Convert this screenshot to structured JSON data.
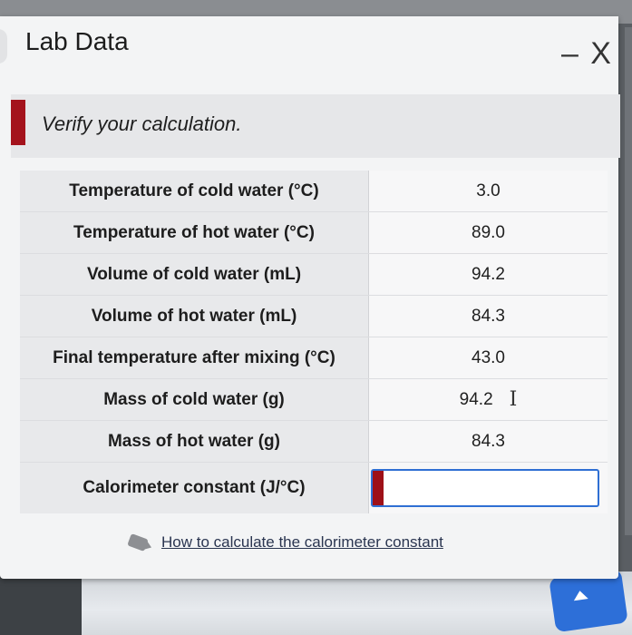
{
  "window": {
    "title": "Lab Data",
    "close_label": "– X"
  },
  "instruction": "Verify your calculation.",
  "table": [
    {
      "label": "Temperature of cold water (°C)",
      "value": "3.0"
    },
    {
      "label": "Temperature of hot water (°C)",
      "value": "89.0"
    },
    {
      "label": "Volume of cold water (mL)",
      "value": "94.2"
    },
    {
      "label": "Volume of hot water (mL)",
      "value": "84.3"
    },
    {
      "label": "Final temperature after mixing (°C)",
      "value": "43.0"
    },
    {
      "label": "Mass of cold water (g)",
      "value": "94.2"
    },
    {
      "label": "Mass of hot water (g)",
      "value": "84.3"
    },
    {
      "label": "Calorimeter constant (J/°C)",
      "value": ""
    }
  ],
  "help": {
    "link_text": "How to calculate the calorimeter constant"
  },
  "colors": {
    "accent_red": "#a4131c",
    "input_border": "#2f6fd3"
  }
}
